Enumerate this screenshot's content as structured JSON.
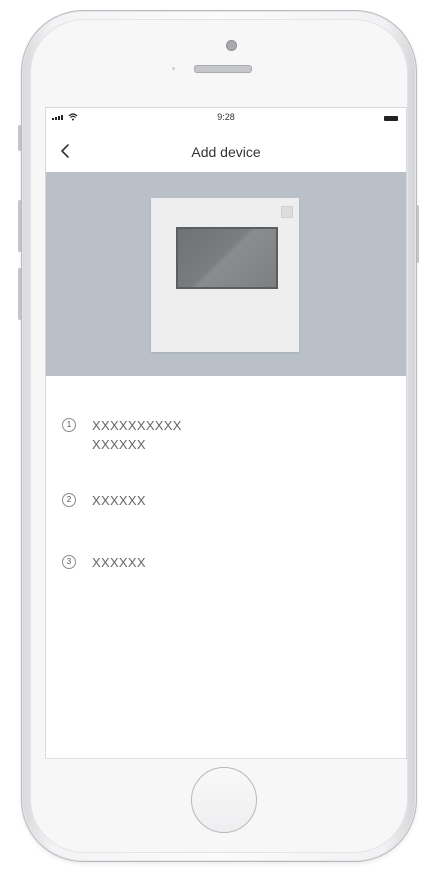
{
  "status_bar": {
    "time": "9:28"
  },
  "nav": {
    "title": "Add device",
    "back_icon": "chevron-left-icon"
  },
  "banner": {
    "background_color": "#b9c0c8",
    "device_icon": "thermostat-panel-icon"
  },
  "steps": [
    {
      "number": "1",
      "line1": "XXXXXXXXXX",
      "line2": "XXXXXX"
    },
    {
      "number": "2",
      "line1": "XXXXXX"
    },
    {
      "number": "3",
      "line1": "XXXXXX"
    }
  ],
  "icons": {
    "signal": "signal-icon",
    "wifi": "wifi-icon",
    "battery": "battery-icon",
    "home": "home-button"
  }
}
